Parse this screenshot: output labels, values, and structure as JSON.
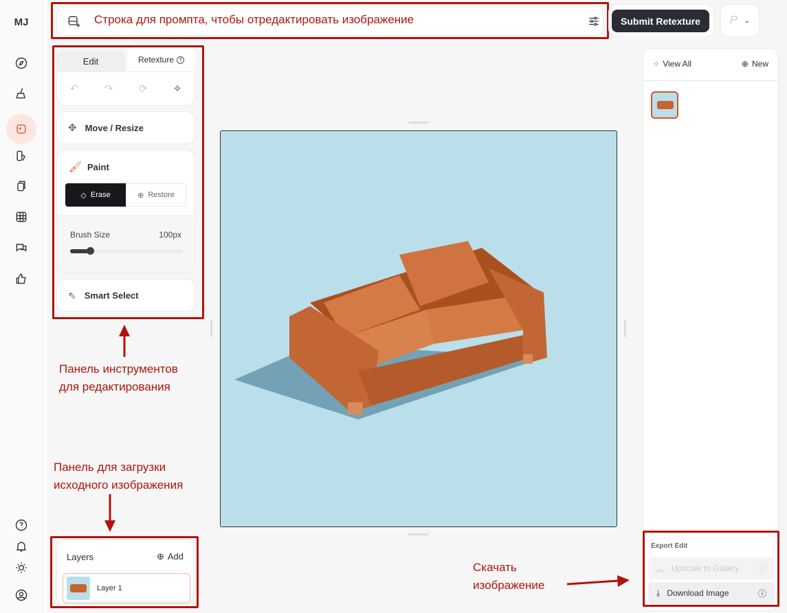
{
  "sidebar": {
    "logo": "MJ",
    "items": [
      "explore-icon",
      "create-icon",
      "edit-icon",
      "personalize-icon",
      "organize-icon",
      "grid-icon",
      "chat-icon",
      "like-icon"
    ],
    "bottom": [
      "help-icon",
      "bell-icon",
      "sun-icon",
      "account-icon"
    ]
  },
  "prompt": {
    "placeholder": "",
    "annotation": "Строка для промпта, чтобы отредактировать изображение"
  },
  "header": {
    "submit_label": "Submit Retexture",
    "profile_initial": "P"
  },
  "tools": {
    "tab_edit": "Edit",
    "tab_retexture": "Retexture",
    "move_resize": "Move / Resize",
    "paint": "Paint",
    "erase": "Erase",
    "restore": "Restore",
    "brush_size_label": "Brush Size",
    "brush_size_value": "100px",
    "brush_fraction": 0.18,
    "smart_select": "Smart Select"
  },
  "layers": {
    "title": "Layers",
    "add": "Add",
    "items": [
      {
        "name": "Layer 1"
      }
    ]
  },
  "right": {
    "view_all": "View All",
    "new": "New",
    "export_title": "Export Edit",
    "upscale": "Upscale to Gallery",
    "download": "Download Image"
  },
  "annotations": {
    "tools_line1": "Панель инструментов",
    "tools_line2": "для редактирования",
    "upload_line1": "Панель для загрузки",
    "upload_line2": "исходного изображения",
    "download_line1": "Скачать",
    "download_line2": "изображение"
  },
  "colors": {
    "accent": "#e8572e",
    "annotation": "#b0140c",
    "canvas_bg": "#badfea",
    "sofa": "#c8642e"
  }
}
